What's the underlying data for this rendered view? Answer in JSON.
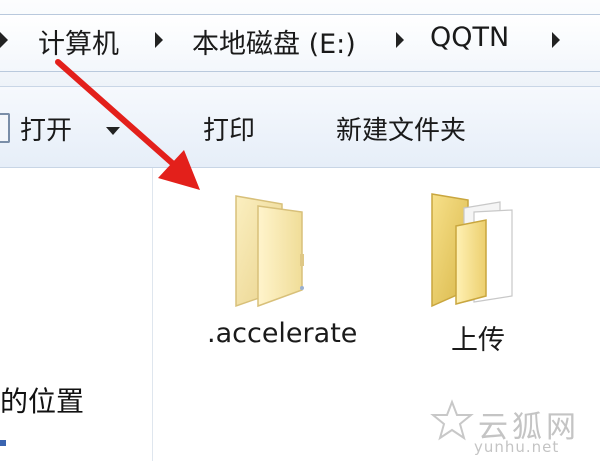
{
  "breadcrumb": {
    "items": [
      "计算机",
      "本地磁盘 (E:)",
      "QQTN"
    ]
  },
  "toolbar": {
    "open_label": "打开",
    "print_label": "打印",
    "new_folder_label": "新建文件夹"
  },
  "nav_pane": {
    "location_text": "的位置"
  },
  "folders": [
    {
      "name": ".accelerate"
    },
    {
      "name": "上传"
    }
  ],
  "watermark": {
    "text_cn": "云狐网",
    "text_en": "yunhu.net"
  },
  "colors": {
    "arrow": "#e3201b",
    "folder_light": "#f6e7a8",
    "folder_dark": "#d9c27a"
  }
}
